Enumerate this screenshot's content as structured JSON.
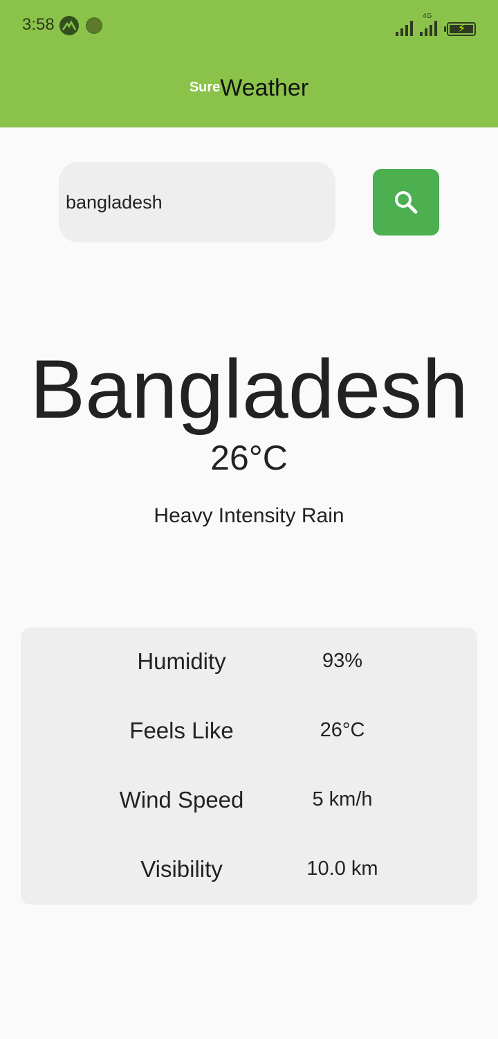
{
  "status_bar": {
    "time": "3:58",
    "network_type": "4G",
    "icons": [
      "mountain-app-icon",
      "sun-app-icon",
      "signal-icon",
      "signal-4g-icon",
      "battery-charging-icon"
    ]
  },
  "app_bar": {
    "title_prefix": "Sure",
    "title_main": "Weather",
    "color": "#8bc34a"
  },
  "search": {
    "value": "bangladesh",
    "button_icon": "search-icon",
    "button_color": "#4caf50"
  },
  "weather": {
    "city": "Bangladesh",
    "temperature": "26°C",
    "condition": "Heavy Intensity Rain"
  },
  "details": [
    {
      "label": "Humidity",
      "value": "93%"
    },
    {
      "label": "Feels Like",
      "value": "26°C"
    },
    {
      "label": "Wind Speed",
      "value": "5 km/h"
    },
    {
      "label": "Visibility",
      "value": "10.0 km"
    }
  ]
}
